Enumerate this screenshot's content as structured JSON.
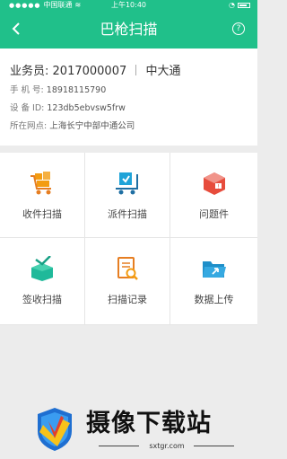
{
  "status_bar": {
    "carrier": "中国联通",
    "time": "上午10:40"
  },
  "header": {
    "title": "巴枪扫描",
    "back_icon": "back-chevron-icon",
    "help_icon": "help-icon"
  },
  "info": {
    "salesman_label": "业务员:",
    "salesman_id": "2017000007",
    "company": "中大通",
    "phone_label": "手 机 号:",
    "phone": "18918115790",
    "device_label": "设 备 ID:",
    "device_id": "123db5ebvsw5frw",
    "branch_label": "所在网点:",
    "branch": "上海长宁中部中通公司"
  },
  "actions": [
    {
      "label": "收件扫描",
      "icon": "cart-boxes-icon"
    },
    {
      "label": "派件扫描",
      "icon": "delivery-cart-icon"
    },
    {
      "label": "问题件",
      "icon": "problem-box-icon"
    },
    {
      "label": "签收扫描",
      "icon": "sign-box-icon"
    },
    {
      "label": "扫描记录",
      "icon": "scan-record-icon"
    },
    {
      "label": "数据上传",
      "icon": "folder-upload-icon"
    }
  ],
  "watermark": {
    "text": "摄像下载站",
    "url": "sxtgr.com"
  },
  "colors": {
    "accent": "#20c08a",
    "blue": "#1fa3d8",
    "orange": "#f39c12"
  }
}
